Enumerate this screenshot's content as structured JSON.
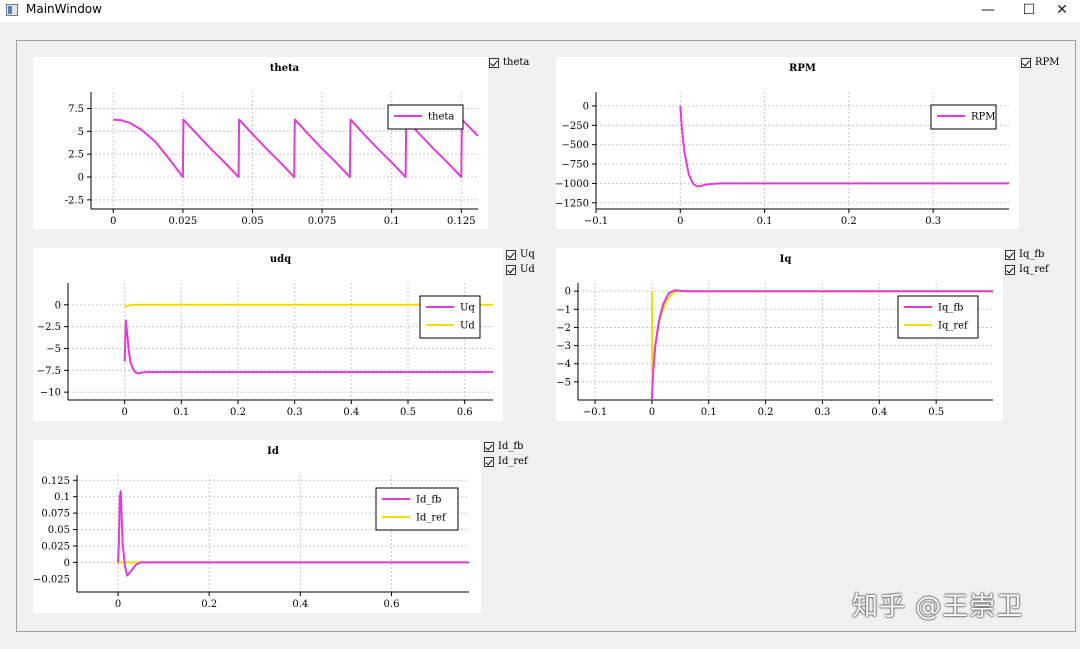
{
  "window": {
    "title": "MainWindow",
    "minimize": "—",
    "maximize": "☐",
    "close": "✕"
  },
  "watermark": "知乎 @王崇卫",
  "colors": {
    "magenta": "#e23bd9",
    "yellow": "#f4d90c",
    "grid": "#c8c8c8"
  },
  "checkboxes": {
    "theta": [
      "theta"
    ],
    "rpm": [
      "RPM"
    ],
    "udq": [
      "Uq",
      "Ud"
    ],
    "iq": [
      "Iq_fb",
      "Iq_ref"
    ],
    "id": [
      "Id_fb",
      "Id_ref"
    ]
  },
  "chart_data": [
    {
      "id": "theta",
      "type": "line",
      "title": "theta",
      "xlim": [
        -0.008,
        0.131
      ],
      "ylim": [
        -3.5,
        9.3
      ],
      "xticks": [
        0,
        0.025,
        0.05,
        0.075,
        0.1,
        0.125
      ],
      "xtick_labels": [
        "0",
        "0.025",
        "0.05",
        "0.075",
        "0.1",
        "0.125"
      ],
      "yticks": [
        -2.5,
        0,
        2.5,
        5,
        7.5
      ],
      "ytick_labels": [
        "-2.5",
        "0",
        "2.5",
        "5",
        "7.5"
      ],
      "legend_position": "top-right",
      "series": [
        {
          "name": "theta",
          "color": "#e23bd9",
          "x": [
            0,
            0.003,
            0.006,
            0.01,
            0.015,
            0.02,
            0.025,
            0.0252,
            0.03,
            0.035,
            0.04,
            0.045,
            0.0452,
            0.05,
            0.055,
            0.06,
            0.065,
            0.0652,
            0.07,
            0.075,
            0.08,
            0.085,
            0.0852,
            0.09,
            0.095,
            0.1,
            0.105,
            0.1052,
            0.11,
            0.115,
            0.12,
            0.125,
            0.1252,
            0.131
          ],
          "y": [
            6.28,
            6.2,
            5.9,
            5.2,
            3.9,
            2.0,
            0.0,
            6.28,
            4.7,
            3.1,
            1.6,
            0.0,
            6.28,
            4.7,
            3.1,
            1.6,
            0.0,
            6.28,
            4.7,
            3.1,
            1.6,
            0.0,
            6.28,
            4.7,
            3.1,
            1.6,
            0.0,
            6.28,
            4.7,
            3.1,
            1.6,
            0.0,
            6.28,
            4.5
          ]
        }
      ]
    },
    {
      "id": "rpm",
      "type": "line",
      "title": "RPM",
      "xlim": [
        -0.1,
        0.39
      ],
      "ylim": [
        -1330,
        180
      ],
      "xticks": [
        -0.1,
        0,
        0.1,
        0.2,
        0.3
      ],
      "xtick_labels": [
        "−0.1",
        "0",
        "0.1",
        "0.2",
        "0.3"
      ],
      "yticks": [
        -1250,
        -1000,
        -750,
        -500,
        -250,
        0
      ],
      "ytick_labels": [
        "−1250",
        "−1000",
        "−750",
        "−500",
        "−250",
        "0"
      ],
      "legend_position": "top-right",
      "series": [
        {
          "name": "RPM",
          "color": "#e23bd9",
          "x": [
            0,
            0.002,
            0.005,
            0.01,
            0.015,
            0.02,
            0.025,
            0.03,
            0.04,
            0.05,
            0.1,
            0.2,
            0.3,
            0.39
          ],
          "y": [
            0,
            -300,
            -600,
            -880,
            -1000,
            -1040,
            -1030,
            -1015,
            -1005,
            -1000,
            -1000,
            -1000,
            -1000,
            -1000
          ]
        }
      ]
    },
    {
      "id": "udq",
      "type": "line",
      "title": "udq",
      "xlim": [
        -0.1,
        0.65
      ],
      "ylim": [
        -10.9,
        2.5
      ],
      "xticks": [
        0,
        0.1,
        0.2,
        0.3,
        0.4,
        0.5,
        0.6
      ],
      "xtick_labels": [
        "0",
        "0.1",
        "0.2",
        "0.3",
        "0.4",
        "0.5",
        "0.6"
      ],
      "yticks": [
        -10,
        -7.5,
        -5,
        -2.5,
        0
      ],
      "ytick_labels": [
        "−10",
        "−7.5",
        "−5",
        "−2.5",
        "0"
      ],
      "legend_position": "top-right",
      "series": [
        {
          "name": "Uq",
          "color": "#e23bd9",
          "x": [
            0,
            0.002,
            0.004,
            0.007,
            0.01,
            0.015,
            0.02,
            0.025,
            0.03,
            0.04,
            0.05,
            0.1,
            0.65
          ],
          "y": [
            -6.5,
            -1.8,
            -3.0,
            -5.0,
            -6.5,
            -7.4,
            -7.8,
            -7.85,
            -7.75,
            -7.7,
            -7.7,
            -7.7,
            -7.7
          ]
        },
        {
          "name": "Ud",
          "color": "#f4d90c",
          "x": [
            0,
            0.01,
            0.02,
            0.05,
            0.65
          ],
          "y": [
            -0.2,
            -0.05,
            0.0,
            0.0,
            0.0
          ]
        }
      ]
    },
    {
      "id": "iq",
      "type": "line",
      "title": "Iq",
      "xlim": [
        -0.13,
        0.6
      ],
      "ylim": [
        -6.0,
        0.45
      ],
      "xticks": [
        -0.1,
        0,
        0.1,
        0.2,
        0.3,
        0.4,
        0.5
      ],
      "xtick_labels": [
        "−0.1",
        "0",
        "0.1",
        "0.2",
        "0.3",
        "0.4",
        "0.5"
      ],
      "yticks": [
        -5,
        -4,
        -3,
        -2,
        -1,
        0
      ],
      "ytick_labels": [
        "−5",
        "−4",
        "−3",
        "−2",
        "−1",
        "0"
      ],
      "legend_position": "top-right",
      "series": [
        {
          "name": "Iq_fb",
          "color": "#e23bd9",
          "x": [
            0,
            0.002,
            0.006,
            0.012,
            0.02,
            0.03,
            0.04,
            0.05,
            0.06,
            0.1,
            0.6
          ],
          "y": [
            -6.0,
            -4.6,
            -3.0,
            -1.7,
            -0.7,
            -0.1,
            0.05,
            0.02,
            0.0,
            0.0,
            0.0
          ]
        },
        {
          "name": "Iq_ref",
          "color": "#f4d90c",
          "x": [
            0,
            0.0005,
            0.002,
            0.008,
            0.015,
            0.025,
            0.035,
            0.045,
            0.06,
            0.6
          ],
          "y": [
            0.0,
            -4.5,
            -3.8,
            -2.6,
            -1.4,
            -0.6,
            -0.15,
            0.0,
            0.0,
            0.0
          ]
        }
      ]
    },
    {
      "id": "id",
      "type": "line",
      "title": "Id",
      "xlim": [
        -0.09,
        0.77
      ],
      "ylim": [
        -0.045,
        0.133
      ],
      "xticks": [
        0,
        0.2,
        0.4,
        0.6
      ],
      "xtick_labels": [
        "0",
        "0.2",
        "0.4",
        "0.6"
      ],
      "yticks": [
        0,
        0.025,
        0.05,
        0.075,
        0.1,
        0.125
      ],
      "ytick_labels": [
        "0",
        "0.025",
        "0.05",
        "0.075",
        "0.1",
        "0.125"
      ],
      "extra_ytick_label": "−0.025",
      "legend_position": "top-right",
      "series": [
        {
          "name": "Id_fb",
          "color": "#e23bd9",
          "x": [
            0,
            0.002,
            0.004,
            0.006,
            0.01,
            0.015,
            0.02,
            0.03,
            0.04,
            0.05,
            0.1,
            0.77
          ],
          "y": [
            0.0,
            0.03,
            0.1,
            0.108,
            0.03,
            -0.005,
            -0.02,
            -0.012,
            -0.003,
            0.0,
            0.0,
            0.0
          ]
        },
        {
          "name": "Id_ref",
          "color": "#f4d90c",
          "x": [
            0,
            0.77
          ],
          "y": [
            0.0,
            0.0
          ]
        }
      ]
    }
  ]
}
